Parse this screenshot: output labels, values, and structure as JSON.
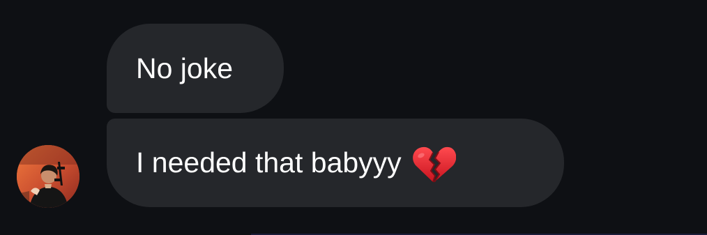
{
  "messages": [
    {
      "text": "No joke"
    },
    {
      "text": "I needed that babyyy",
      "emoji": "broken-heart"
    }
  ],
  "theme": {
    "background": "#0e1014",
    "bubble": "#25272b",
    "text": "#ffffff",
    "emoji_red": "#d81f2b"
  },
  "avatar": {
    "icon": "avatar"
  }
}
